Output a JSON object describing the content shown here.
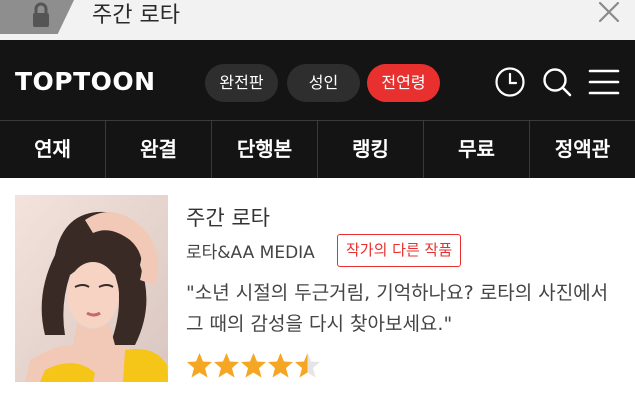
{
  "browser": {
    "title": "주간 로타",
    "lock_icon": "lock-icon",
    "close_icon": "close-icon"
  },
  "header": {
    "logo": "TOPTOON",
    "filters": [
      "완전판",
      "성인",
      "전연령"
    ],
    "active_filter": "전연령",
    "icons": [
      "clock-icon",
      "search-icon",
      "menu-icon"
    ],
    "accent_color": "#e8312e"
  },
  "nav": {
    "items": [
      "연재",
      "완결",
      "단행본",
      "랭킹",
      "무료",
      "정액관"
    ]
  },
  "series": {
    "title": "주간 로타",
    "author": "로타&AA MEDIA",
    "other_works_label": "작가의 다른 작품",
    "description": "\"소년 시절의 두근거림, 기억하나요? 로타의 사진에서 그 때의 감성을 다시 찾아보세요.\"",
    "rating": 4.5,
    "rating_max": 5
  }
}
